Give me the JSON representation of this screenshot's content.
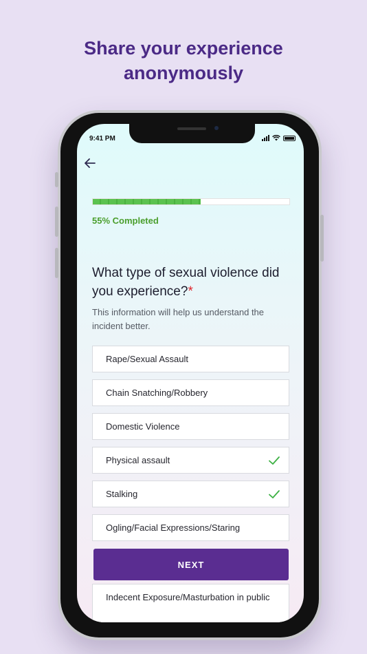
{
  "headline": {
    "line1": "Share your experience",
    "line2": "anonymously"
  },
  "status_bar": {
    "time": "9:41 PM"
  },
  "progress": {
    "percent": 55,
    "label": "55% Completed"
  },
  "question": {
    "text": "What type of sexual violence did you experience?",
    "required_mark": "*",
    "helper": "This information will help us understand the incident better."
  },
  "options": [
    {
      "label": "Rape/Sexual Assault",
      "selected": false
    },
    {
      "label": "Chain Snatching/Robbery",
      "selected": false
    },
    {
      "label": "Domestic Violence",
      "selected": false
    },
    {
      "label": "Physical assault",
      "selected": true
    },
    {
      "label": "Stalking",
      "selected": true
    },
    {
      "label": "Ogling/Facial Expressions/Staring",
      "selected": false
    },
    {
      "label": "Indecent Exposure/Masturbation in public",
      "selected": false
    }
  ],
  "next_button": {
    "label": "NEXT"
  },
  "colors": {
    "brand": "#5a2d91",
    "progress": "#5bc24f",
    "check": "#3cb043",
    "required": "#e0242b"
  }
}
